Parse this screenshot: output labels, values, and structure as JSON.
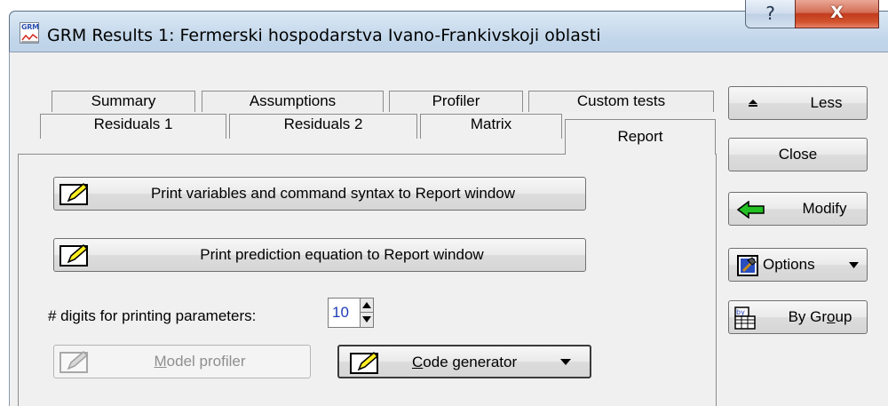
{
  "window": {
    "title": "GRM Results 1: Fermerski hospodarstva Ivano-Frankivskoji oblasti",
    "icon_text": "GRM",
    "help_glyph": "?",
    "close_glyph": "X"
  },
  "tabs": {
    "row_back": [
      "Summary",
      "Assumptions",
      "Profiler",
      "Custom tests"
    ],
    "row_front": [
      "Residuals 1",
      "Residuals 2",
      "Matrix",
      "Report"
    ],
    "active": "Report"
  },
  "report": {
    "print_vars_label": "Print variables and command syntax to Report window",
    "print_eq_label": "Print prediction equation to Report window",
    "digits_label": "# digits for printing parameters:",
    "digits_value": "10",
    "model_profiler_label": "Model profiler",
    "model_profiler_mnemonic": "M",
    "model_profiler_rest": "odel profiler",
    "code_gen_mnemonic": "C",
    "code_gen_rest": "ode generator"
  },
  "side": {
    "less_label": "Less",
    "close_label": "Close",
    "modify_label": "Modify",
    "options_label": "Options",
    "bygroup_pre": "By Gr",
    "bygroup_mnemonic": "o",
    "bygroup_post": "up",
    "bygroup_icon_text": "by"
  },
  "colors": {
    "title_bg": "#c2d6ea",
    "close_red": "#c23b1c",
    "modify_arrow": "#22c022",
    "digits_text": "#1e3cb4"
  }
}
